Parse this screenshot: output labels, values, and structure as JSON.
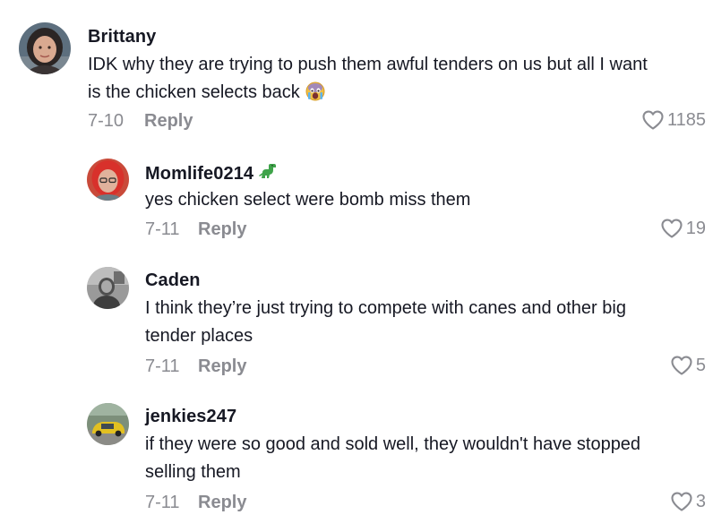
{
  "comments": [
    {
      "username": "Brittany",
      "lines": [
        "IDK why they are trying to push them awful tenders on us but all I want",
        "is the chicken selects back"
      ],
      "date": "7-10",
      "reply": "Reply",
      "likes": "1185",
      "emoji": "crying-face-emoji"
    },
    {
      "username": "Momlife0214",
      "lines": [
        "yes chicken select were bomb miss them"
      ],
      "date": "7-11",
      "reply": "Reply",
      "likes": "19",
      "badge": "dinosaur-emoji"
    },
    {
      "username": "Caden",
      "lines": [
        "I think they’re just trying to compete with canes and other big",
        "tender places"
      ],
      "date": "7-11",
      "reply": "Reply",
      "likes": "5"
    },
    {
      "username": "jenkies247",
      "lines": [
        "if they were so good and sold well, they wouldn't have stopped",
        "selling them"
      ],
      "date": "7-11",
      "reply": "Reply",
      "likes": "3"
    }
  ],
  "colors": {
    "text": "#161823",
    "muted": "#8a8b91",
    "background": "#ffffff"
  },
  "icons": {
    "like": "heart-outline-icon"
  }
}
